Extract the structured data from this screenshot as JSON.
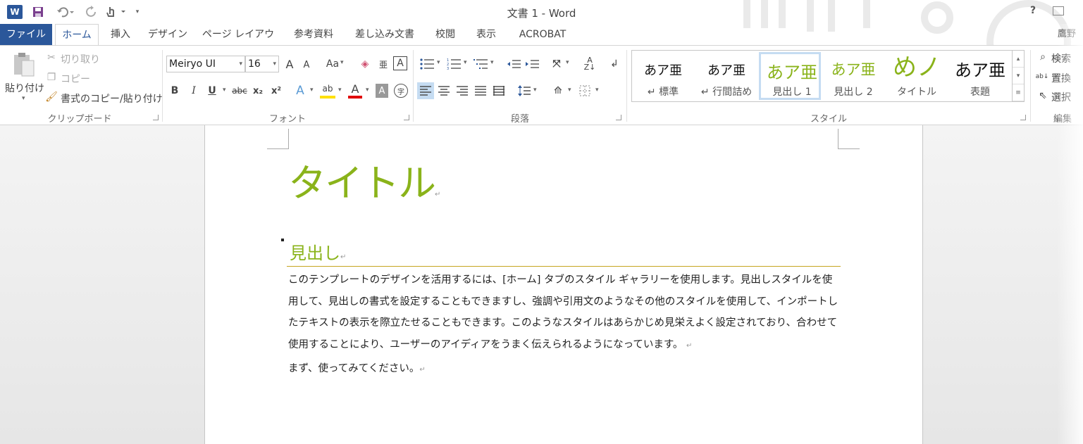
{
  "titlebar": {
    "app_logo": "W",
    "title": "文書 1 - Word",
    "help": "?"
  },
  "tabs": [
    {
      "label": "ファイル"
    },
    {
      "label": "ホーム"
    },
    {
      "label": "挿入"
    },
    {
      "label": "デザイン"
    },
    {
      "label": "ページ レイアウト"
    },
    {
      "label": "参考資料"
    },
    {
      "label": "差し込み文書"
    },
    {
      "label": "校閲"
    },
    {
      "label": "表示"
    },
    {
      "label": "ACROBAT"
    }
  ],
  "clipboard": {
    "paste": "貼り付け",
    "cut": "切り取り",
    "copy": "コピー",
    "format_painter": "書式のコピー/貼り付け",
    "group_label": "クリップボード"
  },
  "font": {
    "name": "Meiryo UI",
    "size": "16",
    "grow": "A",
    "shrink": "A",
    "change_case": "Aa",
    "bold": "B",
    "italic": "I",
    "underline": "U",
    "strikethrough": "abc",
    "subscript": "x₂",
    "superscript": "x²",
    "text_effects": "A",
    "highlight": "ab",
    "font_color": "A",
    "char_shading": "A",
    "enclose": "字",
    "group_label": "フォント",
    "highlight_color": "#ffe000",
    "font_color_value": "#e00000"
  },
  "paragraph": {
    "group_label": "段落"
  },
  "styles": {
    "items": [
      {
        "sample": "あア亜",
        "name": "↵ 標準"
      },
      {
        "sample": "あア亜",
        "name": "↵ 行間詰め"
      },
      {
        "sample": "あア亜",
        "name": "見出し 1"
      },
      {
        "sample": "あア亜",
        "name": "見出し 2"
      },
      {
        "sample": "めノ",
        "name": "タイトル"
      },
      {
        "sample": "あア亜",
        "name": "表題"
      }
    ],
    "group_label": "スタイル",
    "accent_color": "#8ab31a"
  },
  "editing": {
    "find": "検索",
    "replace": "置換",
    "select": "選択",
    "group_label": "編集",
    "account": "鷹野"
  },
  "document": {
    "title": "タイトル",
    "heading": "見出し",
    "body": "このテンプレートのデザインを活用するには、[ホーム] タブのスタイル ギャラリーを使用します。見出しスタイルを使用して、見出しの書式を設定することもできますし、強調や引用文のようなその他のスタイルを使用して、インポートしたテキストの表示を際立たせることもできます。このようなスタイルはあらかじめ見栄えよく設定されており、合わせて使用することにより、ユーザーのアイディアをうまく伝えられるようになっています。",
    "body2": "まず、使ってみてください。",
    "pilcrow": "↵"
  }
}
